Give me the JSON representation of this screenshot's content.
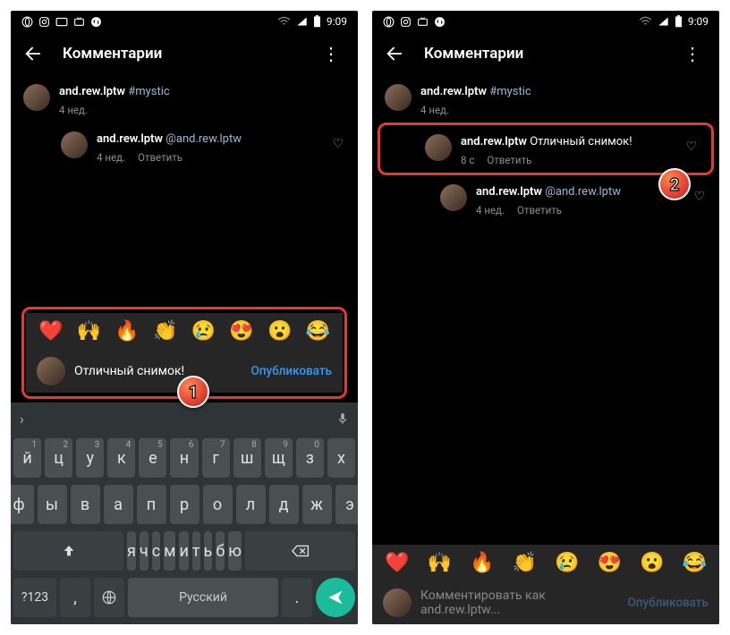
{
  "status": {
    "time": "9:09"
  },
  "header": {
    "title": "Комментарии"
  },
  "left": {
    "post": {
      "user": "and.rew.lptw",
      "text": "#mystic",
      "meta": "4 нед."
    },
    "comment1": {
      "user": "and.rew.lptw",
      "mention": "@and.rew.lptw",
      "meta": "4 нед.",
      "reply": "Ответить"
    },
    "input": {
      "text": "Отличный снимок!",
      "publish": "Опубликовать"
    },
    "keyboard": {
      "space_label": "Русский",
      "numkey": "?123",
      "row1": [
        "й",
        "ц",
        "у",
        "к",
        "е",
        "н",
        "г",
        "ш",
        "щ",
        "з",
        "х"
      ],
      "row1_sup": [
        "1",
        "2",
        "3",
        "4",
        "5",
        "6",
        "7",
        "8",
        "9",
        "0",
        ""
      ],
      "row2": [
        "ф",
        "ы",
        "в",
        "а",
        "п",
        "р",
        "о",
        "л",
        "д",
        "ж",
        "э"
      ],
      "row3": [
        "я",
        "ч",
        "с",
        "м",
        "и",
        "т",
        "ь",
        "б",
        "ю"
      ]
    },
    "callout": "1"
  },
  "right": {
    "post": {
      "user": "and.rew.lptw",
      "text": "#mystic",
      "meta": "4 нед."
    },
    "comment_new": {
      "user": "and.rew.lptw",
      "text": "Отличный снимок!",
      "meta": "8 с",
      "reply": "Ответить"
    },
    "comment2": {
      "user": "and.rew.lptw",
      "mention": "@and.rew.lptw",
      "meta": "4 нед.",
      "reply": "Ответить"
    },
    "input": {
      "placeholder": "Комментировать как and.rew.lptw...",
      "publish": "Опубликовать"
    },
    "callout": "2"
  },
  "emojis": [
    "❤️",
    "🙌",
    "🔥",
    "👏",
    "😢",
    "😍",
    "😮",
    "😂"
  ]
}
